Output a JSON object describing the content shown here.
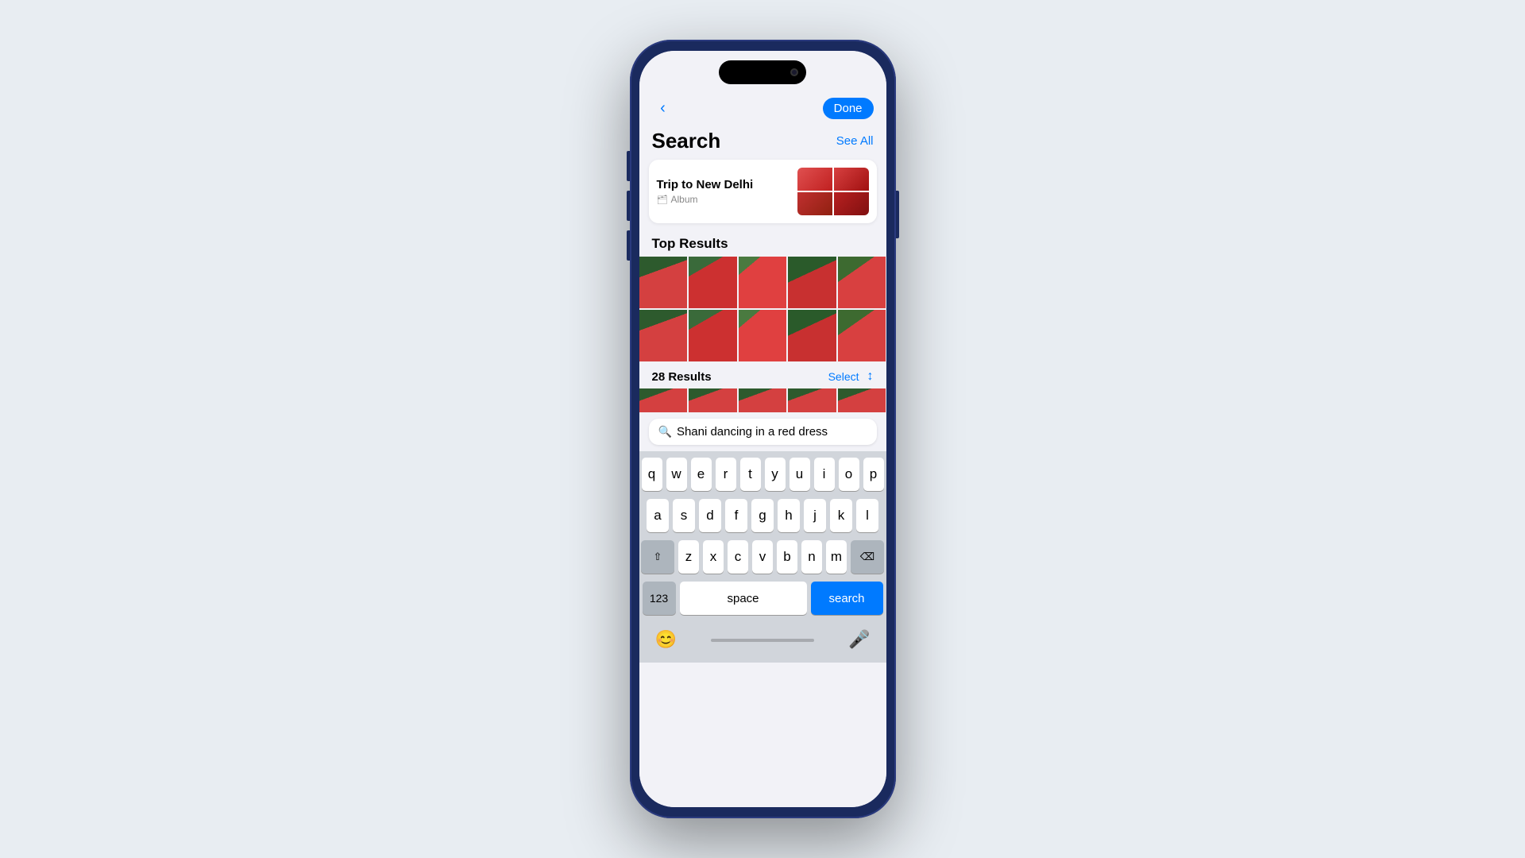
{
  "page": {
    "background_color": "#e8edf2"
  },
  "nav": {
    "back_label": "‹",
    "done_label": "Done"
  },
  "search": {
    "title": "Search",
    "see_all_label": "See All"
  },
  "album_card": {
    "title": "Trip to New Delhi",
    "type_label": "Album",
    "type_icon": "🗂"
  },
  "sections": {
    "top_results_label": "Top Results",
    "results_count_label": "28 Results",
    "select_label": "Select"
  },
  "search_box": {
    "query": "Shani dancing in a red dress"
  },
  "keyboard": {
    "rows": [
      [
        "q",
        "w",
        "e",
        "r",
        "t",
        "y",
        "u",
        "i",
        "o",
        "p"
      ],
      [
        "a",
        "s",
        "d",
        "f",
        "g",
        "h",
        "j",
        "k",
        "l"
      ],
      [
        "z",
        "x",
        "c",
        "v",
        "b",
        "n",
        "m"
      ]
    ],
    "shift_label": "⇧",
    "backspace_label": "⌫",
    "numbers_label": "123",
    "space_label": "space",
    "search_label": "search",
    "emoji_label": "😊",
    "mic_label": "🎤"
  }
}
